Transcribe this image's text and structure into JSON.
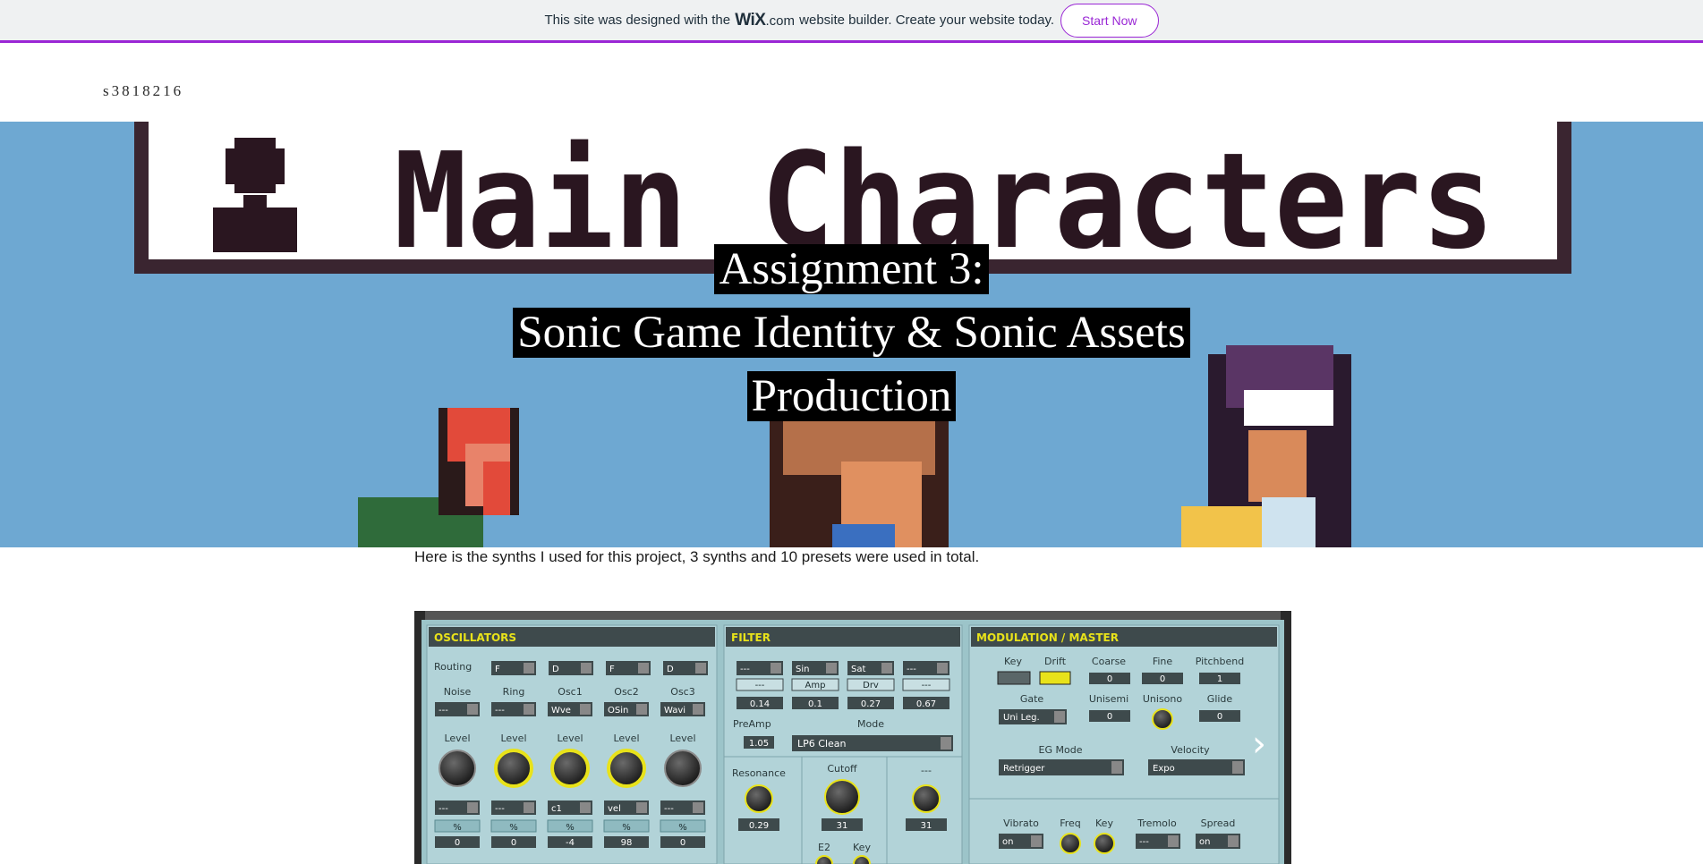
{
  "banner": {
    "text_before": "This site was designed with the",
    "logo_main": "WiX",
    "logo_suffix": ".com",
    "text_after": "website builder. Create your website today.",
    "cta_label": "Start Now"
  },
  "header": {
    "site_name": "s3818216"
  },
  "hero": {
    "background_heading": "Main Characters",
    "title_line1": "Assignment 3:",
    "title_line2": "Sonic Game Identity & Sonic Assets",
    "title_line3": "Production"
  },
  "content": {
    "description": "Here is the synths I used for this project, 3 synths and 10 presets were used in total."
  },
  "synth": {
    "sections": {
      "osc": "OSCILLATORS",
      "filter": "FILTER",
      "mod": "MODULATION / MASTER"
    },
    "osc": {
      "routing_label": "Routing",
      "routing_values": [
        "F",
        "D",
        "F",
        "D"
      ],
      "col_labels": [
        "Noise",
        "Ring",
        "Osc1",
        "Osc2",
        "Osc3"
      ],
      "col_selects": [
        "---",
        "---",
        "Wve",
        "OSin",
        "Wavi"
      ],
      "level_label": "Level",
      "bottom_selects": [
        "---",
        "---",
        "c1",
        "vel",
        "---"
      ],
      "percent": "%",
      "bottom_values": [
        "0",
        "0",
        "-4",
        "98",
        "0"
      ]
    },
    "filter": {
      "selects": [
        "---",
        "Sin",
        "Sat",
        "---"
      ],
      "mini_labels": [
        "---",
        "Amp",
        "Drv",
        "---"
      ],
      "values": [
        "0.14",
        "0.1",
        "0.27",
        "0.67"
      ],
      "preamp_label": "PreAmp",
      "preamp_value": "1.05",
      "mode_label": "Mode",
      "mode_value": "LP6 Clean",
      "resonance_label": "Resonance",
      "resonance_value": "0.29",
      "cutoff_label": "Cutoff",
      "cutoff_value": "31",
      "third_label": "---",
      "third_value": "31",
      "e2_label": "E2",
      "key_label": "Key"
    },
    "mod": {
      "key_label": "Key",
      "drift_label": "Drift",
      "coarse_label": "Coarse",
      "coarse_value": "0",
      "fine_label": "Fine",
      "fine_value": "0",
      "pitchbend_label": "Pitchbend",
      "pitchbend_value": "1",
      "gate_label": "Gate",
      "gate_value": "Uni Leg.",
      "unisemi_label": "Unisemi",
      "unisemi_value": "0",
      "unisono_label": "Unisono",
      "glide_label": "Glide",
      "glide_value": "0",
      "egmode_label": "EG Mode",
      "egmode_value": "Retrigger",
      "velocity_label": "Velocity",
      "velocity_value": "Expo",
      "vibrato_label": "Vibrato",
      "vibrato_value": "on",
      "freq_label": "Freq",
      "key2_label": "Key",
      "tremolo_label": "Tremolo",
      "tremolo_value": "---",
      "spread_label": "Spread",
      "spread_value": "on"
    }
  },
  "gallery": {
    "next_icon": "chevron-right-icon"
  },
  "colors": {
    "wix_purple": "#9a27d5",
    "hero_blue": "#6ea8d2",
    "synth_panel": "#a9cdd3",
    "knob_yellow": "#e8e21a"
  }
}
